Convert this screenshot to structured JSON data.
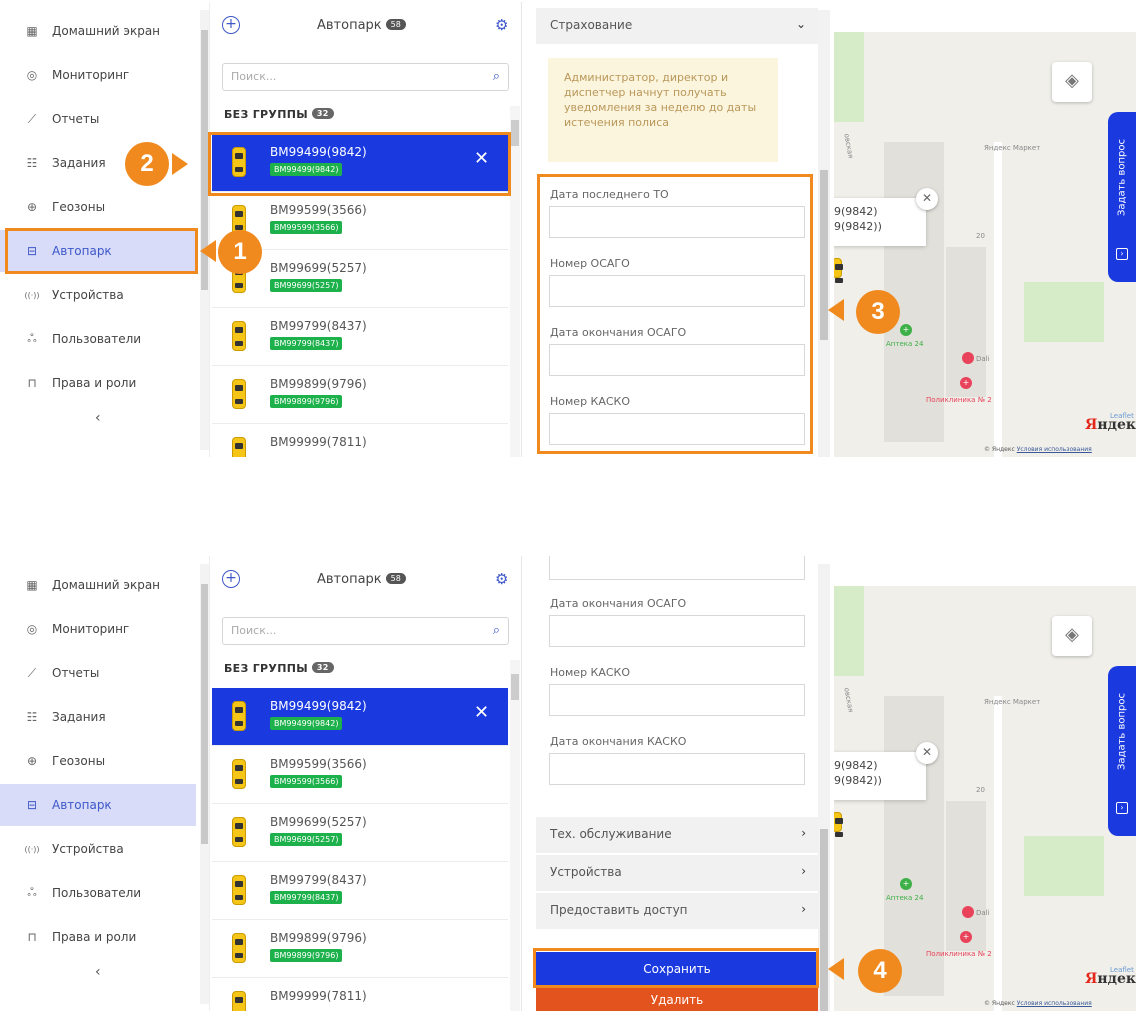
{
  "sidebar": {
    "items": [
      {
        "label": "Домашний экран",
        "icon": "home-screen-icon",
        "glyph": "▦"
      },
      {
        "label": "Мониторинг",
        "icon": "location-pin-icon",
        "glyph": "◎"
      },
      {
        "label": "Отчеты",
        "icon": "chart-line-icon",
        "glyph": "⟋"
      },
      {
        "label": "Задания",
        "icon": "clipboard-icon",
        "glyph": "☷"
      },
      {
        "label": "Геозоны",
        "icon": "globe-icon",
        "glyph": "⊕"
      },
      {
        "label": "Автопарк",
        "icon": "car-icon",
        "glyph": "⊟"
      },
      {
        "label": "Устройства",
        "icon": "signal-icon",
        "glyph": "((·))"
      },
      {
        "label": "Пользователи",
        "icon": "users-icon",
        "glyph": "ஃ"
      },
      {
        "label": "Права и роли",
        "icon": "lock-icon",
        "glyph": "⊓"
      }
    ],
    "active_item": "Автопарк",
    "collapse_glyph": "‹"
  },
  "fleet": {
    "title": "Автопарк",
    "count": "58",
    "search_placeholder": "Поиск...",
    "group_label": "БЕЗ ГРУППЫ",
    "group_count": "32",
    "vehicles": [
      {
        "name": "BM99499(9842)",
        "tag": "BM99499(9842)",
        "selected": true
      },
      {
        "name": "BM99599(3566)",
        "tag": "BM99599(3566)"
      },
      {
        "name": "BM99699(5257)",
        "tag": "BM99699(5257)"
      },
      {
        "name": "BM99799(8437)",
        "tag": "BM99799(8437)"
      },
      {
        "name": "BM99899(9796)",
        "tag": "BM99899(9796)"
      },
      {
        "name": "BM99999(7811)",
        "tag": ""
      }
    ],
    "close_glyph": "✕"
  },
  "form_top": {
    "section_title": "Страхование",
    "notice": "Администратор, директор и диспетчер начнут получать уведомления за неделю до даты истечения полиса",
    "fields": [
      "Дата последнего ТО",
      "Номер ОСАГО",
      "Дата окончания ОСАГО",
      "Номер КАСКО"
    ]
  },
  "form_bottom": {
    "fields": [
      "Дата окончания ОСАГО",
      "Номер КАСКО",
      "Дата окончания КАСКО"
    ],
    "sections": [
      "Тех. обслуживание",
      "Устройства",
      "Предоставить доступ"
    ],
    "save_label": "Сохранить",
    "delete_label": "Удалить"
  },
  "map": {
    "popup_line1": "9(9842)",
    "popup_line2": "9(9842))",
    "ask_label": "Задать вопрос",
    "labels": {
      "market": "Яндекс Маркет",
      "pharmacy": "Аптека 24",
      "dali": "Dali",
      "clinic": "Поликлиника № 2",
      "street": "овская",
      "num20": "20"
    },
    "leaflet": "Leaflet",
    "brand_a": "Я",
    "brand_b": "ндекс",
    "copyright": "© Яндекс",
    "terms": "Условия использования"
  },
  "callouts": [
    "1",
    "2",
    "3",
    "4"
  ],
  "colors": {
    "accent": "#1a3ae0",
    "callout": "#f08a1e",
    "delete": "#e2531e",
    "tag": "#1db14b"
  }
}
